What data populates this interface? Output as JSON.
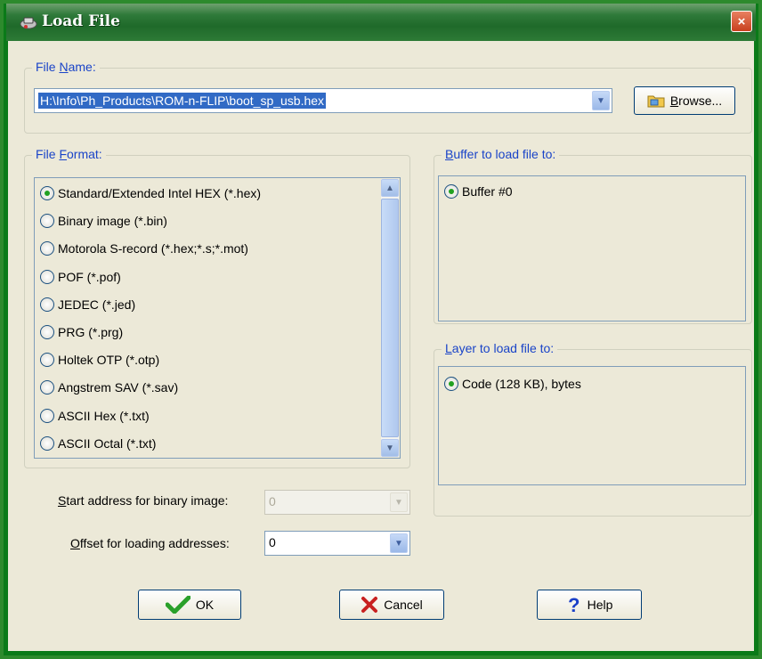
{
  "window": {
    "title": "Load File",
    "close_label": "×"
  },
  "file_name": {
    "legend_pre": "File ",
    "legend_underline": "N",
    "legend_post": "ame:",
    "value": "H:\\Info\\Ph_Products\\ROM-n-FLIP\\boot_sp_usb.hex",
    "browse_underline": "B",
    "browse_post": "rowse..."
  },
  "file_format": {
    "legend_pre": "File ",
    "legend_underline": "F",
    "legend_post": "ormat:",
    "options": [
      {
        "label": "Standard/Extended Intel HEX (*.hex)",
        "checked": true
      },
      {
        "label": "Binary image (*.bin)",
        "checked": false
      },
      {
        "label": "Motorola S-record (*.hex;*.s;*.mot)",
        "checked": false
      },
      {
        "label": "POF (*.pof)",
        "checked": false
      },
      {
        "label": "JEDEC (*.jed)",
        "checked": false
      },
      {
        "label": "PRG (*.prg)",
        "checked": false
      },
      {
        "label": "Holtek OTP (*.otp)",
        "checked": false
      },
      {
        "label": "Angstrem SAV (*.sav)",
        "checked": false
      },
      {
        "label": "ASCII Hex (*.txt)",
        "checked": false
      },
      {
        "label": "ASCII Octal (*.txt)",
        "checked": false
      }
    ]
  },
  "buffer": {
    "legend_underline": "B",
    "legend_post": "uffer to load file to:",
    "option": "Buffer #0"
  },
  "layer": {
    "legend_underline": "L",
    "legend_post": "ayer to load file to:",
    "option": "Code (128 KB), bytes"
  },
  "start_address": {
    "label_underline": "S",
    "label_post": "tart address for binary image:",
    "value": "0"
  },
  "offset": {
    "label_underline": "O",
    "label_post": "ffset for loading addresses:",
    "value": "0"
  },
  "buttons": {
    "ok": "OK",
    "cancel": "Cancel",
    "help": "Help"
  },
  "colors": {
    "title_bar": "#1f6a2a",
    "legend_text": "#1a44c8",
    "dialog_bg": "#ece9d8",
    "selection": "#316ac5"
  }
}
